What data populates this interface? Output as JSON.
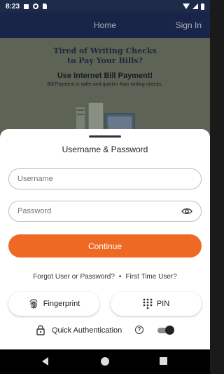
{
  "status_bar": {
    "time": "8:23"
  },
  "header": {
    "home": "Home",
    "sign_in": "Sign In"
  },
  "promo": {
    "headline_line1": "Tired of Writing Checks",
    "headline_line2": "to Pay Your Bills?",
    "subhead": "Use Internet Bill Payment!",
    "text": "Bill Payment is safer and quicker than writing checks."
  },
  "sheet": {
    "title": "Username & Password",
    "username_placeholder": "Username",
    "password_placeholder": "Password",
    "continue_label": "Continue",
    "forgot_link": "Forgot User or Password?",
    "separator": "•",
    "first_time_link": "First Time User?",
    "fingerprint_label": "Fingerprint",
    "pin_label": "PIN",
    "quick_auth_label": "Quick Authentication",
    "help_glyph": "?",
    "quick_auth_enabled": true
  },
  "colors": {
    "accent": "#ee6a24",
    "header_bg": "#1d2b55",
    "status_bg": "#1d2a4a"
  }
}
